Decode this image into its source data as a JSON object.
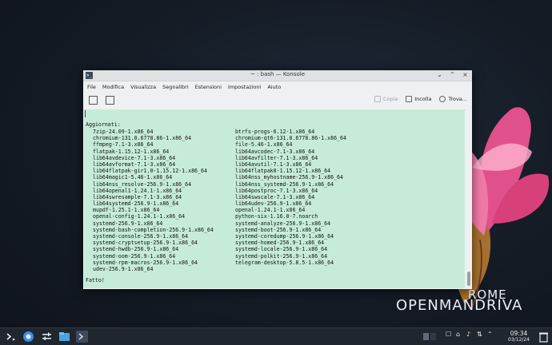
{
  "window": {
    "title": "~ : bash — Konsole",
    "app_icon": ">_"
  },
  "menu": [
    "File",
    "Modifica",
    "Visualizza",
    "Segnalibri",
    "Estensioni",
    "Impostazioni",
    "Aiuto"
  ],
  "toolbar": {
    "copy_label": "Copia",
    "paste_label": "Incolla",
    "find_label": "Trova..."
  },
  "terminal": {
    "heading": "Aggiornati:",
    "col1": [
      "7zip-24.09-1.x86_64",
      "chromium-131.0.6778.86-1.x86_64",
      "ffmpeg-7.1-3.x86_64",
      "flatpak-1.15.12-1.x86_64",
      "lib64avdevice-7.1-3.x86_64",
      "lib64avformat-7.1-3.x86_64",
      "lib64flatpak-gir1.0-1.15.12-1.x86_64",
      "lib64magic1-5.46-1.x86_64",
      "lib64nss_resolve-256.9-1.x86_64",
      "lib64openal1-1.24.1-1.x86_64",
      "lib64swresample-7.1-3.x86_64",
      "lib64systemd-256.9-1.x86_64",
      "mupdf-1.25.1-1.x86_64",
      "openal-config-1.24.1-1.x86_64",
      "systemd-256.9-1.x86_64",
      "systemd-bash-completion-256.9-1.x86_64",
      "systemd-console-256.9-1.x86_64",
      "systemd-cryptsetup-256.9-1.x86_64",
      "systemd-hwdb-256.9-1.x86_64",
      "systemd-oom-256.9-1.x86_64",
      "systemd-rpm-macros-256.9-1.x86_64",
      "udev-256.9-1.x86_64"
    ],
    "col2": [
      "btrfs-progs-6.12-1.x86_64",
      "chromium-qt6-131.0.6778.86-1.x86_64",
      "file-5.46-1.x86_64",
      "lib64avcodec-7.1-3.x86_64",
      "lib64avfilter-7.1-3.x86_64",
      "lib64avutil-7.1-3.x86_64",
      "lib64flatpak0-1.15.12-1.x86_64",
      "lib64nss_myhostname-256.9-1.x86_64",
      "lib64nss_systemd-256.9-1.x86_64",
      "lib64postproc-7.1-3.x86_64",
      "lib64swscale-7.1-3.x86_64",
      "lib64udev-256.9-1.x86_64",
      "openal-1.24.1-1.x86_64",
      "python-six-1.16.0-7.noarch",
      "systemd-analyze-256.9-1.x86_64",
      "systemd-boot-256.9-1.x86_64",
      "systemd-coredump-256.9-1.x86_64",
      "systemd-homed-256.9-1.x86_64",
      "systemd-locale-256.9-1.x86_64",
      "systemd-polkit-256.9-1.x86_64",
      "telegram-desktop-5.8.5-1.x86_64"
    ],
    "done": "Fatto!"
  },
  "desktop": {
    "logo_line1": "ROME",
    "logo_line2": "OPENMANDRIVA"
  },
  "taskbar": {
    "time": "09:34",
    "date": "03/12/24"
  },
  "colors": {
    "terminal_bg": "#c6ecd9",
    "desktop_bg": "#141b25",
    "taskbar_bg": "#20262e",
    "flower_pink": "#e0508a"
  }
}
